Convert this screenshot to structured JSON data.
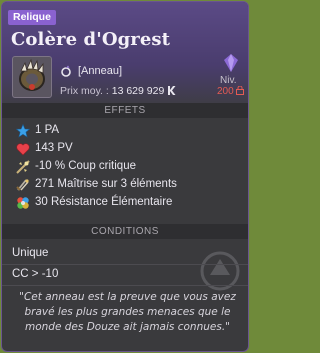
{
  "tooltip": {
    "rarity": "Relique",
    "title": "Colère d'Ogrest",
    "type": "[Anneau]",
    "price_label": "Prix moy. :",
    "price_value": "13 629 929",
    "level_label": "Niv.",
    "level_value": "200",
    "effects_header": "EFFETS",
    "effects": [
      {
        "icon": "star-icon",
        "text": "1 PA"
      },
      {
        "icon": "heart-icon",
        "text": "143 PV"
      },
      {
        "icon": "critical-icon",
        "text": "-10 % Coup critique"
      },
      {
        "icon": "mastery-icon",
        "text": "271 Maîtrise sur 3 éléments"
      },
      {
        "icon": "elemental-resistance-icon",
        "text": "30 Résistance Élémentaire"
      }
    ],
    "conditions_header": "CONDITIONS",
    "conditions": [
      "Unique",
      "CC > -10"
    ],
    "description": "\"Cet anneau est la preuve que vous avez bravé les plus grandes menaces que le monde des Douze ait jamais connues.\""
  },
  "colors": {
    "rarity": "#8a62d0",
    "level": "#e35b53"
  }
}
